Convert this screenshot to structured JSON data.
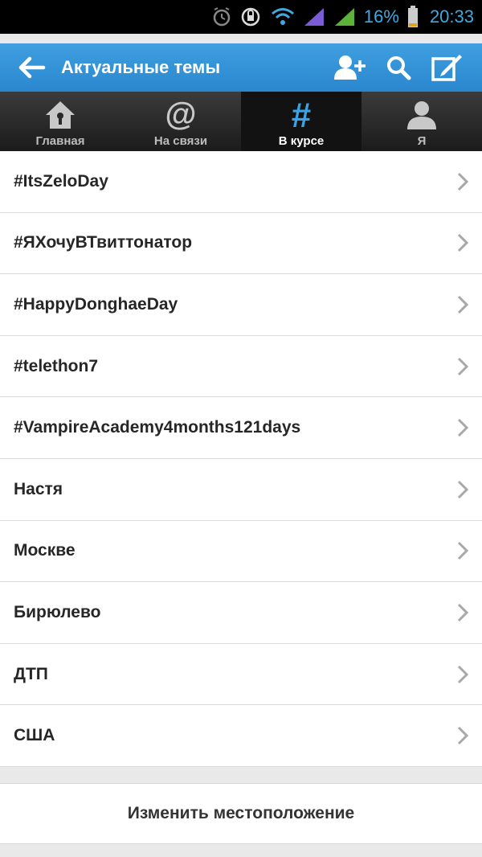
{
  "status_bar": {
    "battery_percent": "16%",
    "time": "20:33",
    "icons": [
      "alarm-icon",
      "sync-icon",
      "wifi-icon",
      "signal-icon",
      "signal-icon",
      "battery-icon"
    ]
  },
  "action_bar": {
    "title": "Актуальные темы",
    "back_icon": "back-arrow-icon",
    "actions": [
      "add-user-icon",
      "search-icon",
      "compose-icon"
    ],
    "color": "#2f91d6"
  },
  "tabs": [
    {
      "label": "Главная",
      "icon": "home-icon",
      "active": false
    },
    {
      "label": "На связи",
      "icon": "at-icon",
      "active": false
    },
    {
      "label": "В курсе",
      "icon": "hashtag-icon",
      "active": true
    },
    {
      "label": "Я",
      "icon": "profile-icon",
      "active": false
    }
  ],
  "trends": [
    {
      "label": "#ItsZeloDay"
    },
    {
      "label": "#ЯХочуВТвиттонатор"
    },
    {
      "label": "#HappyDonghaeDay"
    },
    {
      "label": "#telethon7"
    },
    {
      "label": "#VampireAcademy4months121days"
    },
    {
      "label": "Настя"
    },
    {
      "label": "Москве"
    },
    {
      "label": "Бирюлево"
    },
    {
      "label": "ДТП"
    },
    {
      "label": "США"
    }
  ],
  "change_location_label": "Изменить местоположение"
}
